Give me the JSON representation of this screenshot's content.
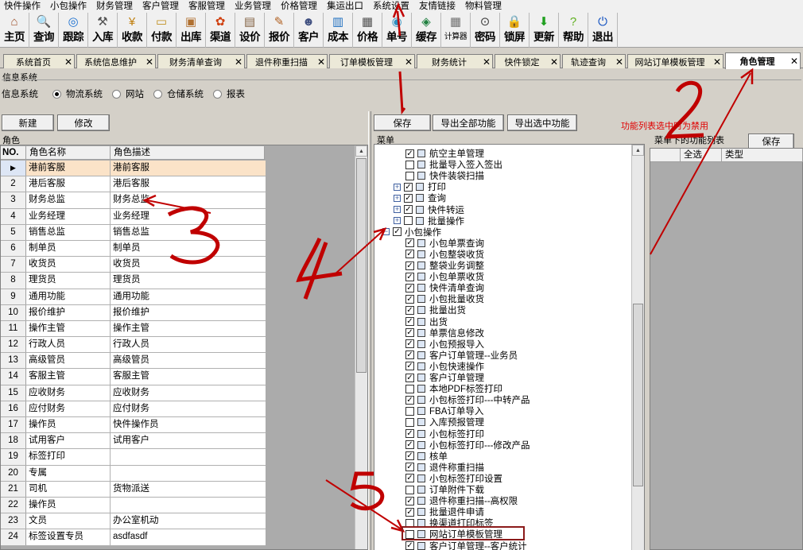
{
  "menu": [
    "快件操作",
    "小包操作",
    "财务管理",
    "客户管理",
    "客服管理",
    "业务管理",
    "价格管理",
    "集运出口",
    "系统设置",
    "友情链接",
    "物料管理"
  ],
  "toolbar": [
    {
      "label": "主页",
      "icon": "home-icon",
      "glyph": "⌂",
      "color": "#a0522d"
    },
    {
      "label": "查询",
      "icon": "search-icon",
      "glyph": "🔍",
      "color": "#1e5fb4"
    },
    {
      "label": "跟踪",
      "icon": "radar-icon",
      "glyph": "◎",
      "color": "#1a6fd0"
    },
    {
      "label": "入库",
      "icon": "hammer-icon",
      "glyph": "⚒",
      "color": "#505050"
    },
    {
      "label": "收款",
      "icon": "yen-icon",
      "glyph": "¥",
      "color": "#c08010"
    },
    {
      "label": "付款",
      "icon": "wallet-icon",
      "glyph": "▭",
      "color": "#c09020"
    },
    {
      "label": "出库",
      "icon": "forklift-icon",
      "glyph": "▣",
      "color": "#b07030"
    },
    {
      "label": "渠道",
      "icon": "channel-icon",
      "glyph": "✿",
      "color": "#d04010"
    },
    {
      "label": "设价",
      "icon": "price-set-icon",
      "glyph": "▤",
      "color": "#806040"
    },
    {
      "label": "报价",
      "icon": "quote-icon",
      "glyph": "✎",
      "color": "#b06020"
    },
    {
      "label": "客户",
      "icon": "customer-icon",
      "glyph": "☻",
      "color": "#405080"
    },
    {
      "label": "成本",
      "icon": "cost-chart-icon",
      "glyph": "▥",
      "color": "#2070c0"
    },
    {
      "label": "价格",
      "icon": "price-icon",
      "glyph": "▦",
      "color": "#505050"
    },
    {
      "label": "单号",
      "icon": "order-number-icon",
      "glyph": "◉",
      "color": "#3090c0"
    },
    {
      "label": "缓存",
      "icon": "cache-icon",
      "glyph": "◈",
      "color": "#208040"
    },
    {
      "label": "计算器",
      "icon": "calculator-icon",
      "glyph": "▦",
      "color": "#707070",
      "small": true
    },
    {
      "label": "密码",
      "icon": "password-icon",
      "glyph": "⊙",
      "color": "#404040"
    },
    {
      "label": "锁屏",
      "icon": "lock-icon",
      "glyph": "🔒",
      "color": "#606060"
    },
    {
      "label": "更新",
      "icon": "update-arrow-icon",
      "glyph": "⬇",
      "color": "#20a020"
    },
    {
      "label": "帮助",
      "icon": "help-icon",
      "glyph": "?",
      "color": "#60b020"
    },
    {
      "label": "退出",
      "icon": "exit-icon",
      "glyph": "⏻",
      "color": "#1050c0"
    }
  ],
  "tabs": [
    {
      "label": "系统首页",
      "active": false
    },
    {
      "label": "系统信息维护",
      "active": false
    },
    {
      "label": "财务清单查询",
      "active": false
    },
    {
      "label": "退件称重扫描",
      "active": false
    },
    {
      "label": "订单模板管理",
      "active": false
    },
    {
      "label": "财务统计",
      "active": false
    },
    {
      "label": "快件锁定",
      "active": false
    },
    {
      "label": "轨迹查询",
      "active": false
    },
    {
      "label": "网站订单模板管理",
      "active": false
    },
    {
      "label": "角色管理",
      "active": true
    }
  ],
  "info": {
    "group_title": "信息系统",
    "label": "信息系统",
    "options": [
      {
        "label": "物流系统",
        "checked": true
      },
      {
        "label": "网站",
        "checked": false
      },
      {
        "label": "仓储系统",
        "checked": false
      },
      {
        "label": "报表",
        "checked": false
      }
    ]
  },
  "left_buttons": {
    "new": "新建",
    "edit": "修改"
  },
  "role_group": "角色",
  "role_columns": {
    "no": "NO.",
    "name": "角色名称",
    "desc": "角色描述"
  },
  "roles": [
    {
      "no": "1",
      "name": "港前客服",
      "desc": "港前客服"
    },
    {
      "no": "2",
      "name": "港后客服",
      "desc": "港后客服"
    },
    {
      "no": "3",
      "name": "财务总监",
      "desc": "财务总监"
    },
    {
      "no": "4",
      "name": "业务经理",
      "desc": "业务经理"
    },
    {
      "no": "5",
      "name": "销售总监",
      "desc": "销售总监"
    },
    {
      "no": "6",
      "name": "制单员",
      "desc": "制单员"
    },
    {
      "no": "7",
      "name": "收货员",
      "desc": "收货员"
    },
    {
      "no": "8",
      "name": "理货员",
      "desc": "理货员"
    },
    {
      "no": "9",
      "name": "通用功能",
      "desc": "通用功能"
    },
    {
      "no": "10",
      "name": "报价维护",
      "desc": "报价维护"
    },
    {
      "no": "11",
      "name": "操作主管",
      "desc": "操作主管"
    },
    {
      "no": "12",
      "name": "行政人员",
      "desc": "行政人员"
    },
    {
      "no": "13",
      "name": "高级管员",
      "desc": "高级管员"
    },
    {
      "no": "14",
      "name": "客服主管",
      "desc": "客服主管"
    },
    {
      "no": "15",
      "name": "应收财务",
      "desc": "应收财务"
    },
    {
      "no": "16",
      "name": "应付财务",
      "desc": "应付财务"
    },
    {
      "no": "17",
      "name": "操作员",
      "desc": "快件操作员"
    },
    {
      "no": "18",
      "name": "试用客户",
      "desc": "试用客户"
    },
    {
      "no": "19",
      "name": "标签打印",
      "desc": ""
    },
    {
      "no": "20",
      "name": "专属",
      "desc": ""
    },
    {
      "no": "21",
      "name": "司机",
      "desc": "货物派送"
    },
    {
      "no": "22",
      "name": "操作员",
      "desc": ""
    },
    {
      "no": "23",
      "name": "文员",
      "desc": "办公室机动"
    },
    {
      "no": "24",
      "name": "标签设置专员",
      "desc": "asdfasdf"
    }
  ],
  "mid_buttons": {
    "save": "保存",
    "export_all": "导出全部功能",
    "export_selected": "导出选中功能"
  },
  "hint_text": "功能列表选中时为禁用",
  "hint_color": "#e00000",
  "menu_group": "菜单",
  "tree": [
    {
      "label": "航空主单管理",
      "level": 2,
      "checked": true,
      "icon": true
    },
    {
      "label": "批量导入签入签出",
      "level": 2,
      "checked": false,
      "icon": true
    },
    {
      "label": "快件装袋扫描",
      "level": 2,
      "checked": false,
      "icon": true
    },
    {
      "label": "打印",
      "level": 1,
      "checked": true,
      "icon": true,
      "expander": "+"
    },
    {
      "label": "查询",
      "level": 1,
      "checked": true,
      "icon": true,
      "expander": "+"
    },
    {
      "label": "快件转运",
      "level": 1,
      "checked": true,
      "icon": true,
      "expander": "+"
    },
    {
      "label": "批量操作",
      "level": 1,
      "checked": false,
      "icon": true,
      "expander": "+"
    },
    {
      "label": "小包操作",
      "level": 0,
      "checked": true,
      "icon": false,
      "expander": "−"
    },
    {
      "label": "小包单票查询",
      "level": 2,
      "checked": true,
      "icon": true
    },
    {
      "label": "小包整袋收货",
      "level": 2,
      "checked": true,
      "icon": true
    },
    {
      "label": "整袋业务调整",
      "level": 2,
      "checked": true,
      "icon": true
    },
    {
      "label": "小包单票收货",
      "level": 2,
      "checked": true,
      "icon": true
    },
    {
      "label": "快件清单查询",
      "level": 2,
      "checked": true,
      "icon": true
    },
    {
      "label": "小包批量收货",
      "level": 2,
      "checked": true,
      "icon": true
    },
    {
      "label": "批量出货",
      "level": 2,
      "checked": true,
      "icon": true
    },
    {
      "label": "出货",
      "level": 2,
      "checked": true,
      "icon": true
    },
    {
      "label": "单票信息修改",
      "level": 2,
      "checked": true,
      "icon": true
    },
    {
      "label": "小包预报导入",
      "level": 2,
      "checked": true,
      "icon": true
    },
    {
      "label": "客户订单管理--业务员",
      "level": 2,
      "checked": true,
      "icon": true
    },
    {
      "label": "小包快速操作",
      "level": 2,
      "checked": true,
      "icon": true
    },
    {
      "label": "客户订单管理",
      "level": 2,
      "checked": true,
      "icon": true
    },
    {
      "label": "本地PDF标签打印",
      "level": 2,
      "checked": false,
      "icon": true
    },
    {
      "label": "小包标签打印---中转产品",
      "level": 2,
      "checked": true,
      "icon": true
    },
    {
      "label": "FBA订单导入",
      "level": 2,
      "checked": false,
      "icon": true
    },
    {
      "label": "入库预报管理",
      "level": 2,
      "checked": false,
      "icon": true
    },
    {
      "label": "小包标签打印",
      "level": 2,
      "checked": true,
      "icon": true
    },
    {
      "label": "小包标签打印---修改产品",
      "level": 2,
      "checked": true,
      "icon": true
    },
    {
      "label": "核单",
      "level": 2,
      "checked": true,
      "icon": true
    },
    {
      "label": "退件称重扫描",
      "level": 2,
      "checked": true,
      "icon": true
    },
    {
      "label": "小包标签打印设置",
      "level": 2,
      "checked": true,
      "icon": true
    },
    {
      "label": "订单附件下载",
      "level": 2,
      "checked": false,
      "icon": true
    },
    {
      "label": "退件称重扫描--高权限",
      "level": 2,
      "checked": true,
      "icon": true
    },
    {
      "label": "批量退件申请",
      "level": 2,
      "checked": true,
      "icon": true
    },
    {
      "label": "换渠道打印标签",
      "level": 2,
      "checked": false,
      "icon": true
    },
    {
      "label": "网站订单模板管理",
      "level": 2,
      "checked": false,
      "icon": true,
      "highlight": true
    },
    {
      "label": "客户订单管理--客户统计",
      "level": 2,
      "checked": true,
      "icon": true
    }
  ],
  "right_group": "菜单下的功能列表",
  "right_save": "保存",
  "right_columns": {
    "select_all": "全选",
    "type": "类型"
  },
  "annotations": [
    "1",
    "2",
    "3",
    "4",
    "5"
  ],
  "annotation_color": "#c00000",
  "highlight_color": "#8b1a1a"
}
